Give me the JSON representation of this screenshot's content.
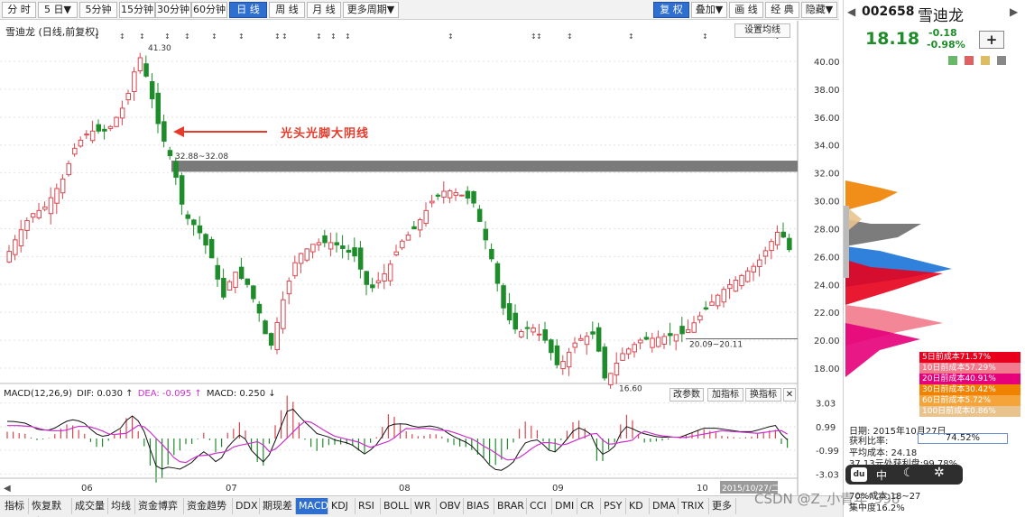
{
  "toolbar": {
    "period_buttons": [
      "分 时",
      "5 日▼",
      "5分钟",
      "15分钟",
      "30分钟",
      "60分钟",
      "日 线",
      "周 线",
      "月 线",
      "更多周期▼"
    ],
    "right_buttons": [
      "复 权",
      "叠加▼",
      "画 线",
      "经 典",
      "隐藏▼"
    ],
    "active_period": "日 线",
    "active_right": "复 权"
  },
  "chart": {
    "title": "雪迪龙  (日线,前复权)",
    "setting_button": "设置均线",
    "annotation": "光头光脚大阴线",
    "high_label": "41.30",
    "low_label": "16.60",
    "band_label": "32.88~32.08",
    "range_label": "20.09~20.11",
    "y_ticks": [
      "40.00",
      "38.00",
      "36.00",
      "34.00",
      "32.00",
      "30.00",
      "28.00",
      "26.00",
      "24.00",
      "22.00",
      "20.00",
      "18.00"
    ],
    "x_months": [
      "06",
      "07",
      "08",
      "09",
      "10"
    ],
    "date_tag": "2015/10/27/二"
  },
  "macd": {
    "name": "MACD(12,26,9)",
    "dif": "DIF: 0.030 ↑",
    "dea": "DEA: -0.095 ↑",
    "macd_val": "MACD: 0.250 ↓",
    "buttons": [
      "改参数",
      "加指标",
      "换指标"
    ],
    "close": "✕",
    "y_ticks": [
      "3.03",
      "0.99",
      "-0.99",
      "-3.03"
    ]
  },
  "tabs": [
    "指标",
    "恢复默认",
    "成交量",
    "均线",
    "资金博弈",
    "资金趋势",
    "DDX",
    "期现差",
    "MACD",
    "KDJ",
    "RSI",
    "BOLL",
    "WR",
    "OBV",
    "BIAS",
    "BRAR",
    "CCI",
    "DMI",
    "CR",
    "PSY",
    "KD",
    "DMA",
    "TRIX",
    "更多"
  ],
  "active_tab": "MACD",
  "stock": {
    "code": "002658",
    "name": "雪迪龙",
    "price": "18.18",
    "change": "-0.18",
    "change_pct": "-0.98%",
    "plus": "+",
    "prev": "◀",
    "next": "▶"
  },
  "cost_legend": [
    {
      "label": "5日前成本71.57%",
      "color": "#e8001c"
    },
    {
      "label": "10日前成本57.29%",
      "color": "#f27a8c"
    },
    {
      "label": "20日前成本40.91%",
      "color": "#e6007a"
    },
    {
      "label": "30日前成本30.42%",
      "color": "#f08200"
    },
    {
      "label": "60日前成本5.72%",
      "color": "#f4a43a"
    },
    {
      "label": "100日前成本0.86%",
      "color": "#e9c38e"
    }
  ],
  "info": {
    "date": "日期: 2015年10月27日",
    "profit_label": "获利比率:",
    "profit_value": "74.52%",
    "avg_cost": "平均成本: 24.18",
    "line4": "37.13元处获利盘:99.78%",
    "line5": "70%成本:18~27",
    "line6": "集中度16.2%"
  },
  "watermark": "CSDN @Z_小青年°998",
  "colors": {
    "up": "#d9474f",
    "down": "#1e8c2a",
    "accent": "#2f6fcf",
    "dif": "#111111",
    "dea": "#cc33cc"
  },
  "float_icons": [
    "du-icon",
    "中",
    "moon-icon",
    "gear-icon"
  ]
}
